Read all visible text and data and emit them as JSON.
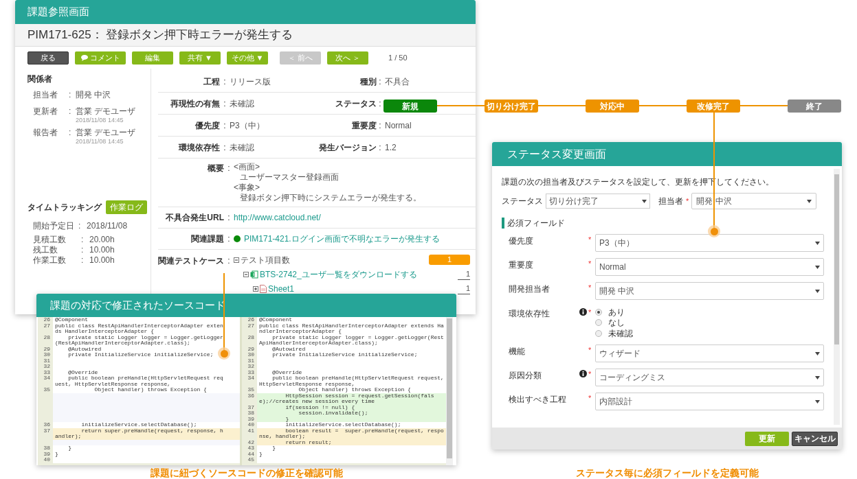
{
  "issue_screen": {
    "banner": "課題参照画面",
    "title": "PIM171-625： 登録ボタン押下時エラーが発生する",
    "toolbar": [
      {
        "label": "戻る",
        "kind": "dark",
        "disabled": false
      },
      {
        "label": "コメント",
        "kind": "comment",
        "disabled": false
      },
      {
        "label": "編集",
        "kind": "green",
        "disabled": false
      },
      {
        "label": "共有 ▼",
        "kind": "green",
        "disabled": false
      },
      {
        "label": "その他 ▼",
        "kind": "green",
        "disabled": false
      },
      {
        "label": "＜ 前へ",
        "kind": "green",
        "disabled": true
      },
      {
        "label": "次へ ＞",
        "kind": "green",
        "disabled": false
      }
    ],
    "pager": "1 / 50",
    "people": {
      "heading": "関係者",
      "rows": [
        {
          "label": "担当者",
          "sep": ":",
          "value": "開発 中沢"
        },
        {
          "label": "更新者",
          "sep": ":",
          "value": "営業 デモユーザ",
          "date": "2018/11/08 14:45"
        },
        {
          "label": "報告者",
          "sep": ":",
          "value": "営業 デモユーザ",
          "date": "2018/11/08 14:45"
        }
      ]
    },
    "time_tracking": {
      "heading": "タイムトラッキング",
      "button": "作業ログ",
      "rows": [
        {
          "label": "開始予定日",
          "sep": ":",
          "value": "2018/11/08"
        },
        {
          "label": "見積工数",
          "sep": ":",
          "value": "20.00h"
        },
        {
          "label": "残工数",
          "sep": ":",
          "value": "10.00h"
        },
        {
          "label": "作業工数",
          "sep": ":",
          "value": "10.00h"
        }
      ]
    },
    "fields": [
      {
        "label": "工程",
        "sep": ":",
        "value": "リリース版",
        "label2": "種別",
        "sep2": ":",
        "value2": "不具合"
      },
      {
        "label": "再現性の有無",
        "sep": ":",
        "value": "未確認",
        "label2": "ステータス",
        "sep2": ":"
      },
      {
        "label": "優先度",
        "sep": ":",
        "value": "P3（中）",
        "label2": "重要度",
        "sep2": ":",
        "value2": "Normal"
      },
      {
        "label": "環境依存性",
        "sep": ":",
        "value": "未確認",
        "label2": "発生バージョン",
        "sep2": ":",
        "value2": "1.2"
      }
    ],
    "details": [
      {
        "kind": "text",
        "label": "概要",
        "sep": ":",
        "lines": [
          {
            "text": "<画面>",
            "indented": false
          },
          {
            "text": "ユーザーマスター登録画面",
            "indented": true
          },
          {
            "text": "<事象>",
            "indented": false
          },
          {
            "text": "登録ボタン押下時にシステムエラーが発生する。",
            "indented": true
          }
        ]
      },
      {
        "kind": "link",
        "label": "不具合発生URL",
        "sep": ":",
        "value": "http://www.catcloud.net/"
      },
      {
        "kind": "related",
        "label": "関連課題",
        "sep": ":",
        "value": "PIM171-421.ログイン画面で不明なエラーが発生する",
        "color": "#0a8a0a"
      },
      {
        "kind": "tree",
        "label": "関連テストケース",
        "sep": ":",
        "tree": [
          {
            "kind": "group",
            "label": "テスト項目数",
            "count": "1",
            "expanded": true,
            "children": [
              {
                "kind": "case",
                "label": "BTS-2742_ユーザ一覧をダウンロードする",
                "count": "1",
                "expanded": true,
                "children": [
                  {
                    "kind": "sheet",
                    "label": "Sheet1",
                    "count": "1",
                    "expanded": false
                  }
                ]
              }
            ]
          }
        ]
      }
    ]
  },
  "status_flow": [
    {
      "label": "新規",
      "color": "#0b870b"
    },
    {
      "label": "切り分け完了",
      "color": "#ee9300"
    },
    {
      "label": "対応中",
      "color": "#ee9300"
    },
    {
      "label": "改修完了",
      "color": "#ee9300"
    },
    {
      "label": "終了",
      "color": "#888888"
    }
  ],
  "code_screen": {
    "banner": "課題の対応で修正されたソースコード",
    "panes": [
      {
        "lines": [
          {
            "number": "26",
            "text": "@Component",
            "kind": "normal"
          },
          {
            "number": "27",
            "text": "public class RestApiHandlerInterceptorAdapter extends HandlerInterceptorAdapter {",
            "kind": "normal"
          },
          {
            "number": "28",
            "text": "    private static Logger logger = Logger.getLogger(RestApiHandlerInterceptorAdapter.class);",
            "kind": "normal"
          },
          {
            "number": "29",
            "text": "    @Autowired",
            "kind": "normal"
          },
          {
            "number": "30",
            "text": "    private InitializeService initializeService;",
            "kind": "normal"
          },
          {
            "number": "31",
            "kind": "normal"
          },
          {
            "number": "32",
            "kind": "normal"
          },
          {
            "number": "33",
            "text": "    @Override",
            "kind": "normal"
          },
          {
            "number": "34",
            "text": "    public boolean preHandle(HttpServletRequest request, HttpServletResponse response,",
            "kind": "normal"
          },
          {
            "number": "35",
            "text": "            Object handler) throws Exception {",
            "kind": "normal"
          },
          {
            "kind": "empty"
          },
          {
            "kind": "empty"
          },
          {
            "kind": "empty"
          },
          {
            "kind": "empty"
          },
          {
            "kind": "empty"
          },
          {
            "number": "36",
            "text": "        initializeService.selectDatabase();",
            "kind": "normal"
          },
          {
            "number": "37",
            "text": "        return super.preHandle(request, response, handler);",
            "kind": "changed"
          },
          {
            "kind": "empty"
          },
          {
            "number": "38",
            "text": "    }",
            "kind": "normal"
          },
          {
            "number": "39",
            "text": "}",
            "kind": "normal"
          },
          {
            "number": "40",
            "kind": "normal"
          }
        ]
      },
      {
        "lines": [
          {
            "number": "26",
            "text": "@Component",
            "kind": "normal"
          },
          {
            "number": "27",
            "text": "public class RestApiHandlerInterceptorAdapter extends HandlerInterceptorAdapter {",
            "kind": "normal"
          },
          {
            "number": "28",
            "text": "    private static Logger logger = Logger.getLogger(RestApiHandlerInterceptorAdapter.class);",
            "kind": "normal"
          },
          {
            "number": "29",
            "text": "    @Autowired",
            "kind": "normal"
          },
          {
            "number": "30",
            "text": "    private InitializeService initializeService;",
            "kind": "normal"
          },
          {
            "number": "31",
            "kind": "normal"
          },
          {
            "number": "32",
            "kind": "normal"
          },
          {
            "number": "33",
            "text": "    @Override",
            "kind": "normal"
          },
          {
            "number": "34",
            "text": "    public boolean preHandle(HttpServletRequest request, HttpServletResponse response,",
            "kind": "normal"
          },
          {
            "number": "35",
            "text": "            Object handler) throws Exception {",
            "kind": "normal"
          },
          {
            "number": "36",
            "text": "        HttpSession session = request.getSession(false);//creates new session every time",
            "kind": "added"
          },
          {
            "number": "37",
            "text": "        if(session != null) {",
            "kind": "added"
          },
          {
            "number": "38",
            "text": "            session.invalidate();",
            "kind": "added"
          },
          {
            "number": "39",
            "text": "        }",
            "kind": "added"
          },
          {
            "number": "40",
            "text": "        initializeService.selectDatabase();",
            "kind": "normal"
          },
          {
            "number": "41",
            "text": "        boolean result =  super.preHandle(request, response, handler);",
            "kind": "changed"
          },
          {
            "number": "42",
            "text": "        return result;",
            "kind": "changed"
          },
          {
            "number": "43",
            "text": "    }",
            "kind": "normal"
          },
          {
            "number": "44",
            "text": "}",
            "kind": "normal"
          },
          {
            "number": "45",
            "kind": "normal"
          }
        ]
      }
    ]
  },
  "status_change_screen": {
    "banner": "ステータス変更画面",
    "instruction": "課題の次の担当者及びステータスを設定して、更新を押下してください。",
    "status": {
      "label": "ステータス",
      "value": "切り分け完了"
    },
    "assignee": {
      "label": "担当者",
      "mark": "*",
      "value": "開発 中沢"
    },
    "section": "必須フィールド",
    "fields": [
      {
        "kind": "select",
        "label": "優先度",
        "info": false,
        "mark": "*",
        "value": "P3（中）"
      },
      {
        "kind": "select",
        "label": "重要度",
        "info": false,
        "mark": "*",
        "value": "Normal"
      },
      {
        "kind": "select",
        "label": "開発担当者",
        "info": false,
        "mark": "*",
        "value": "開発 中沢"
      },
      {
        "kind": "radio",
        "label": "環境依存性",
        "info": true,
        "mark": "*",
        "options": [
          {
            "label": "あり",
            "selected": true
          },
          {
            "label": "なし",
            "selected": false
          },
          {
            "label": "未確認",
            "selected": false
          }
        ]
      },
      {
        "kind": "select",
        "label": "機能",
        "info": false,
        "mark": "*",
        "value": "ウィザード"
      },
      {
        "kind": "select",
        "label": "原因分類",
        "info": true,
        "mark": "*",
        "value": "コーディングミス"
      },
      {
        "kind": "select",
        "label": "検出すべき工程",
        "info": false,
        "mark": "*",
        "value": "内部設計"
      }
    ],
    "buttons": [
      {
        "label": "更新",
        "kind": "primary"
      },
      {
        "label": "キャンセル",
        "kind": "dark"
      }
    ]
  },
  "captions": [
    "課題に紐づくソースコードの修正を確認可能",
    "ステータス毎に必須フィールドを定義可能"
  ]
}
